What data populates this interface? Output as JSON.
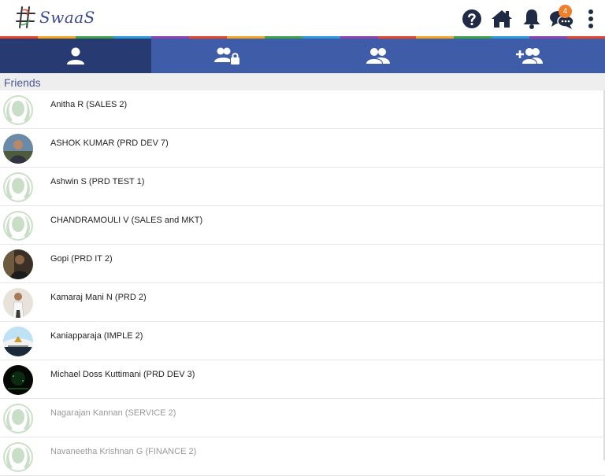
{
  "app": {
    "logo_text": "SwaaS",
    "notification_count": "4"
  },
  "header_icons": [
    "help-icon",
    "home-icon",
    "bell-icon",
    "chat-icon",
    "more-vertical-icon"
  ],
  "stripe_colors": [
    "#e8452c",
    "#f5a623",
    "#3fa34d",
    "#2d9cdb",
    "#8e44ad",
    "#e8452c",
    "#f5a623",
    "#3fa34d",
    "#2d9cdb",
    "#8e44ad",
    "#e8452c",
    "#f5a623",
    "#3fa34d",
    "#2d9cdb",
    "#8e44ad",
    "#e8452c"
  ],
  "tabs": [
    {
      "icon": "person-icon",
      "active": true
    },
    {
      "icon": "group-lock-icon",
      "active": false
    },
    {
      "icon": "group-icon",
      "active": false
    },
    {
      "icon": "add-group-icon",
      "active": false
    }
  ],
  "section": {
    "title": "Friends"
  },
  "friends": [
    {
      "name": "Anitha R (SALES 2)",
      "avatar": "placeholder",
      "dim": false
    },
    {
      "name": "ASHOK KUMAR (PRD DEV 7)",
      "avatar": "photo-outdoor",
      "dim": false
    },
    {
      "name": "Ashwin S (PRD TEST 1)",
      "avatar": "placeholder",
      "dim": false
    },
    {
      "name": "CHANDRAMOULI V (SALES and MKT)",
      "avatar": "placeholder",
      "dim": false
    },
    {
      "name": "Gopi (PRD IT 2)",
      "avatar": "photo-dark",
      "dim": false
    },
    {
      "name": "Kamaraj Mani N (PRD 2)",
      "avatar": "photo-light",
      "dim": false
    },
    {
      "name": "Kaniapparaja (IMPLE 2)",
      "avatar": "photo-sky",
      "dim": false
    },
    {
      "name": "Michael Doss Kuttimani (PRD DEV 3)",
      "avatar": "photo-black",
      "dim": false
    },
    {
      "name": "Nagarajan Kannan (SERVICE 2)",
      "avatar": "placeholder",
      "dim": true
    },
    {
      "name": "Navaneetha Krishnan G (FINANCE 2)",
      "avatar": "placeholder",
      "dim": true
    }
  ],
  "colors": {
    "tab_bar": "#3f5ca8",
    "tab_active": "#283a72",
    "section_text": "#4d5a97",
    "badge": "#f07f2b",
    "icon_dark": "#1f2a44",
    "placeholder_avatar": "#c9dec6"
  }
}
